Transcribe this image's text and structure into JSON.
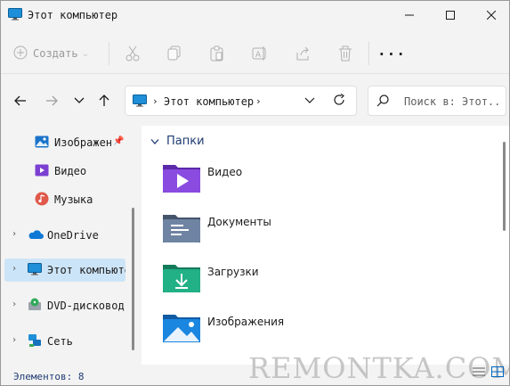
{
  "window": {
    "title": "Этот компьютер",
    "controls": [
      "minimize",
      "maximize",
      "close"
    ]
  },
  "commandbar": {
    "create_label": "Создать",
    "icons": [
      "cut-icon",
      "copy-icon",
      "paste-icon",
      "rename-icon",
      "share-icon",
      "delete-icon"
    ],
    "more_label": "···"
  },
  "navigation": {
    "address": {
      "location": "Этот компьютер"
    },
    "search": {
      "placeholder": "Поиск в: Этот.."
    }
  },
  "sidebar": {
    "items": [
      {
        "label": "Изображен",
        "icon": "pictures-icon",
        "pinned": true
      },
      {
        "label": "Видео",
        "icon": "video-icon"
      },
      {
        "label": "Музыка",
        "icon": "music-icon"
      },
      {
        "label": "OneDrive",
        "icon": "cloud-icon",
        "expandable": true
      },
      {
        "label": "Этот компьютер",
        "icon": "computer-icon",
        "expandable": true,
        "selected": true
      },
      {
        "label": "DVD-дисковод",
        "icon": "dvd-icon",
        "expandable": true
      },
      {
        "label": "Сеть",
        "icon": "network-icon",
        "expandable": true
      }
    ]
  },
  "content": {
    "group_title": "Папки",
    "folders": [
      {
        "label": "Видео",
        "icon": "video-folder-icon",
        "color": "#7b3fd1"
      },
      {
        "label": "Документы",
        "icon": "documents-folder-icon",
        "color": "#5a6e8c"
      },
      {
        "label": "Загрузки",
        "icon": "downloads-folder-icon",
        "color": "#1e9e75"
      },
      {
        "label": "Изображения",
        "icon": "pictures-folder-icon",
        "color": "#1a73c9"
      }
    ]
  },
  "status": {
    "items_count": "Элементов: 8"
  },
  "watermark": "REMONTKA.COM",
  "colors": {
    "accent": "#0067c0",
    "selection": "#cce4f7",
    "group_title": "#1f3b73"
  }
}
